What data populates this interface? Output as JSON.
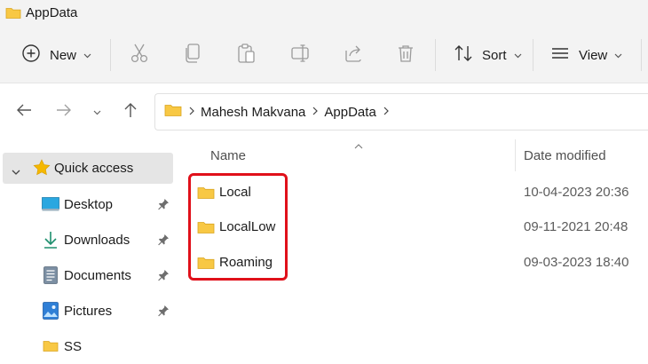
{
  "window": {
    "title": "AppData"
  },
  "toolbar": {
    "new_label": "New",
    "sort_label": "Sort",
    "view_label": "View",
    "icons": [
      "cut-icon",
      "copy-icon",
      "paste-icon",
      "rename-icon",
      "share-icon",
      "delete-icon"
    ]
  },
  "address": {
    "crumbs": [
      "Mahesh Makvana",
      "AppData"
    ]
  },
  "sidebar": {
    "quick_access": "Quick access",
    "items": [
      {
        "label": "Desktop",
        "icon": "desktop-icon",
        "pinned": true
      },
      {
        "label": "Downloads",
        "icon": "download-icon",
        "pinned": true
      },
      {
        "label": "Documents",
        "icon": "document-icon",
        "pinned": true
      },
      {
        "label": "Pictures",
        "icon": "pictures-icon",
        "pinned": true
      },
      {
        "label": "SS",
        "icon": "folder-icon",
        "pinned": false
      }
    ]
  },
  "columns": {
    "name": "Name",
    "date_modified": "Date modified"
  },
  "files": [
    {
      "name": "Local",
      "date": "10-04-2023 20:36"
    },
    {
      "name": "LocalLow",
      "date": "09-11-2021 20:48"
    },
    {
      "name": "Roaming",
      "date": "09-03-2023 18:40"
    }
  ],
  "colors": {
    "folder": "#f8c844",
    "highlight": "#e0101a",
    "selection": "#e5e5e5",
    "star": "#f5b800",
    "accent": "#0067c0"
  }
}
